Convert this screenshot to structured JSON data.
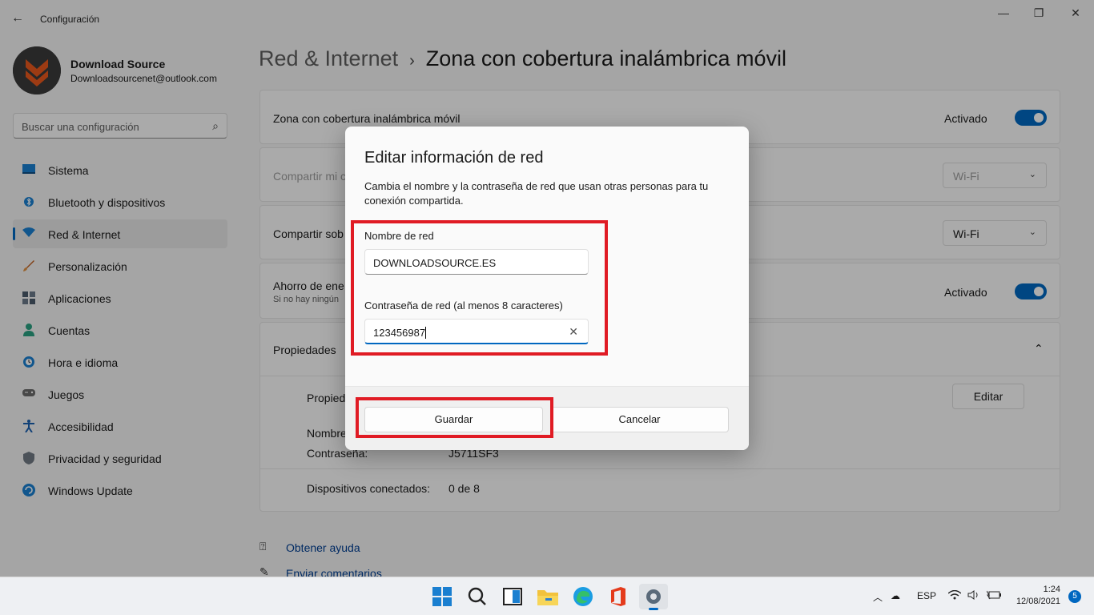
{
  "window": {
    "title": "Configuración",
    "back_icon": "←",
    "minimize": "—",
    "maximize": "❐",
    "close": "✕"
  },
  "profile": {
    "name": "Download Source",
    "email": "Downloadsourcenet@outlook.com"
  },
  "search": {
    "placeholder": "Buscar una configuración",
    "icon": "⌕"
  },
  "nav": [
    {
      "label": "Sistema",
      "icon": "monitor-icon"
    },
    {
      "label": "Bluetooth y dispositivos",
      "icon": "bluetooth-icon"
    },
    {
      "label": "Red & Internet",
      "icon": "wifi-icon",
      "active": true
    },
    {
      "label": "Personalización",
      "icon": "brush-icon"
    },
    {
      "label": "Aplicaciones",
      "icon": "apps-icon"
    },
    {
      "label": "Cuentas",
      "icon": "person-icon"
    },
    {
      "label": "Hora e idioma",
      "icon": "clock-globe-icon"
    },
    {
      "label": "Juegos",
      "icon": "gamepad-icon"
    },
    {
      "label": "Accesibilidad",
      "icon": "accessibility-icon"
    },
    {
      "label": "Privacidad y seguridad",
      "icon": "shield-icon"
    },
    {
      "label": "Windows Update",
      "icon": "update-icon"
    }
  ],
  "breadcrumb": {
    "parent": "Red & Internet",
    "separator": "›",
    "current": "Zona con cobertura inalámbrica móvil"
  },
  "cards": {
    "hotspot": {
      "label": "Zona con cobertura inalámbrica móvil",
      "state": "Activado"
    },
    "share_from": {
      "label": "Compartir mi c",
      "value": "Wi-Fi"
    },
    "share_over": {
      "label": "Compartir sob",
      "value": "Wi-Fi"
    },
    "power": {
      "label": "Ahorro de ene",
      "sub": "Si no hay ningún",
      "state": "Activado"
    },
    "properties": {
      "label": "Propiedades",
      "chevron": "⌃",
      "row1": "Propied",
      "edit": "Editar",
      "name_label": "Nombre",
      "pwd_label": "Contraseña:",
      "pwd_value": "J5711SF3",
      "devices_label": "Dispositivos conectados:",
      "devices_value": "0 de 8"
    }
  },
  "links": {
    "help": "Obtener ayuda",
    "feedback": "Enviar comentarios"
  },
  "dialog": {
    "title": "Editar información de red",
    "description": "Cambia el nombre y la contraseña de red que usan otras personas para tu conexión compartida.",
    "name_label": "Nombre de red",
    "name_value": "DOWNLOADSOURCE.ES",
    "pwd_label": "Contraseña de red (al menos 8 caracteres)",
    "pwd_value": "123456987",
    "clear_icon": "✕",
    "save": "Guardar",
    "cancel": "Cancelar"
  },
  "taskbar": {
    "lang": "ESP",
    "time": "1:24",
    "date": "12/08/2021",
    "notifications": "5"
  },
  "colors": {
    "accent": "#0067c0",
    "highlight": "#e01b24"
  }
}
